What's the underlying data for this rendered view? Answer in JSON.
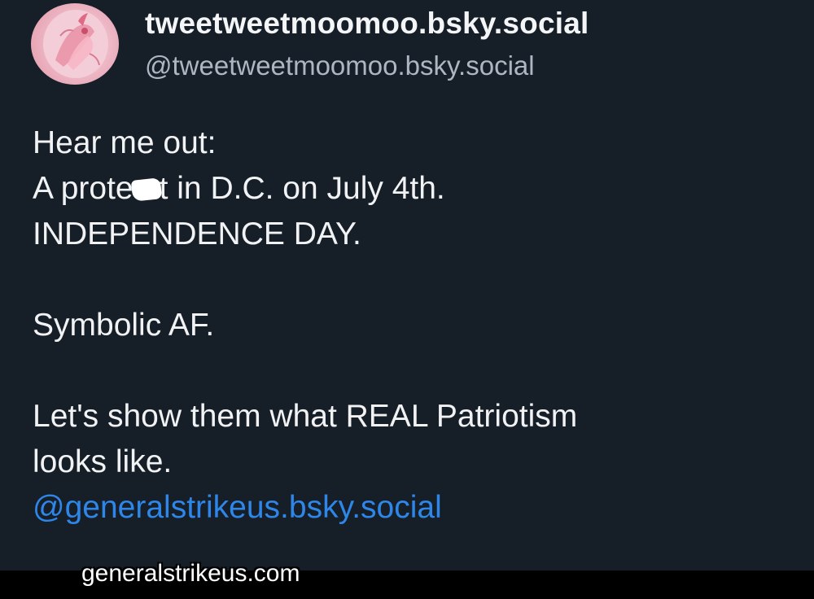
{
  "post": {
    "author": {
      "display_name": "tweetweetmoomoo.bsky.social",
      "handle": "@tweetweetmoomoo.bsky.social"
    },
    "text": {
      "line1": "Hear me out:",
      "line2_before": "A prote",
      "line2_after": "t in D.C. on July 4th.",
      "line3": "INDEPENDENCE DAY.",
      "line4": "Symbolic AF.",
      "line5": "Let's show them what REAL Patriotism",
      "line6": "looks like.",
      "mention": "@generalstrikeus.bsky.social"
    }
  },
  "overlay": {
    "caption": "generalstrikeus.com"
  },
  "colors": {
    "background": "#161e28",
    "mention": "#2e86e8",
    "handle": "#aeb6c2"
  }
}
